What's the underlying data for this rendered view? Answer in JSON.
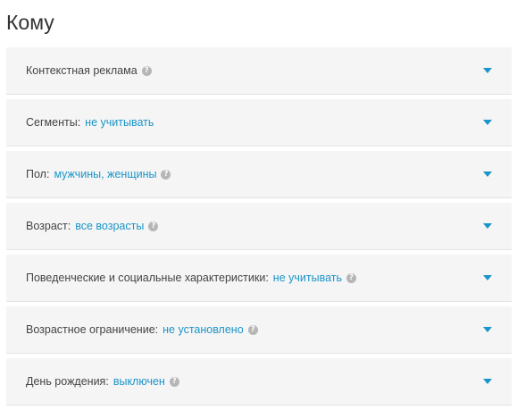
{
  "page": {
    "title": "Кому"
  },
  "sections": [
    {
      "label": "Контекстная реклама",
      "value": "",
      "help": "?"
    },
    {
      "label": "Сегменты:",
      "value": "не учитывать",
      "help": ""
    },
    {
      "label": "Пол:",
      "value": "мужчины, женщины",
      "help": "?"
    },
    {
      "label": "Возраст:",
      "value": "все возрасты",
      "help": "?"
    },
    {
      "label": "Поведенческие и социальные характеристики:",
      "value": "не учитывать",
      "help": "?"
    },
    {
      "label": "Возрастное ограничение:",
      "value": "не установлено",
      "help": "?"
    },
    {
      "label": "День рождения:",
      "value": "выключен",
      "help": "?"
    }
  ],
  "colors": {
    "accent": "#1b95c9",
    "section_bg": "#f5f5f5",
    "text": "#444444",
    "help_icon": "#b6b6b6"
  },
  "icons": {
    "help": "question-circle-icon",
    "expand": "triangle-down-icon"
  }
}
